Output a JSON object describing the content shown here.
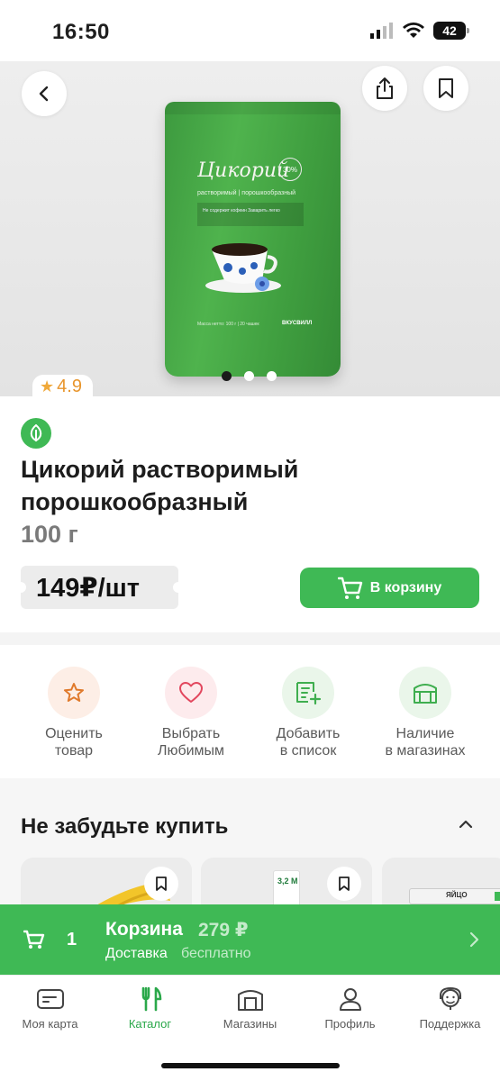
{
  "status_bar": {
    "time": "16:50",
    "battery": "42"
  },
  "hero": {
    "package_title": "Цикорий",
    "package_percent": "30%",
    "package_subtitle": "растворимый  |  порошкообразный",
    "package_band": "Не содержит кофеин   Заварить легко",
    "package_footer": "Масса нетто: 100 г  |  20 чашек",
    "package_brand": "ВКУСВИЛЛ",
    "slides": 3,
    "active_slide": 1
  },
  "rating": {
    "star": "★",
    "value": "4.9"
  },
  "product": {
    "title": "Цикорий растворимый порошкообразный",
    "weight": "100 г",
    "price": "149₽/шт",
    "cart_button": "В корзину"
  },
  "actions": [
    {
      "label": "Оценить\nтовар",
      "icon": "star-icon"
    },
    {
      "label": "Выбрать\nЛюбимым",
      "icon": "heart-icon"
    },
    {
      "label": "Добавить\nв список",
      "icon": "add-to-list-icon"
    },
    {
      "label": "Наличие\nв магазинах",
      "icon": "store-icon"
    }
  ],
  "recommendations": {
    "title": "Не забудьте купить",
    "milk_label": "3,2 М",
    "eggs_label": "ЯЙЦО"
  },
  "cart_bar": {
    "count": "1",
    "title": "Корзина",
    "price": "279 ₽",
    "delivery_label": "Доставка",
    "delivery_value": "бесплатно"
  },
  "tabs": [
    {
      "label": "Моя карта",
      "icon": "card-icon",
      "active": false
    },
    {
      "label": "Каталог",
      "icon": "fork-knife-icon",
      "active": true
    },
    {
      "label": "Магазины",
      "icon": "store-icon",
      "active": false
    },
    {
      "label": "Профиль",
      "icon": "person-icon",
      "active": false
    },
    {
      "label": "Поддержка",
      "icon": "support-icon",
      "active": false
    }
  ],
  "colors": {
    "brand_green": "#3fb955",
    "rating_orange": "#e8952c",
    "tab_active": "#2aa84a"
  }
}
